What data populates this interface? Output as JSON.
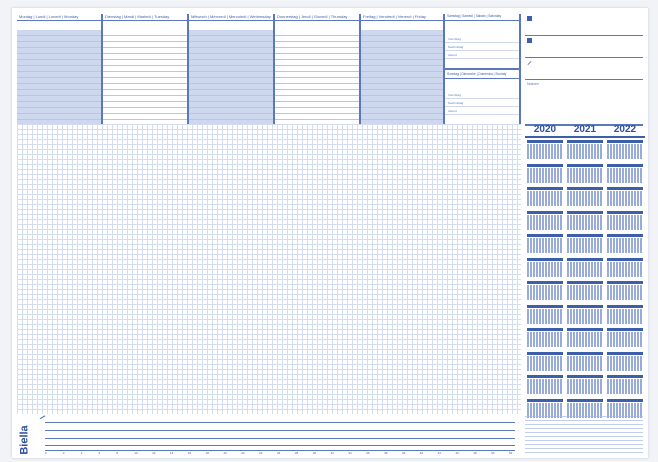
{
  "brand": {
    "name": "Biella"
  },
  "week": {
    "days": [
      {
        "title": "Montag | Lundi | Lunedì | Monday",
        "shaded": true
      },
      {
        "title": "Dienstag | Mardi | Martedì | Tuesday",
        "shaded": false
      },
      {
        "title": "Mittwoch | Mercredi | Mercoledì | Wednesday",
        "shaded": true
      },
      {
        "title": "Donnerstag | Jeudi | Giovedì | Thursday",
        "shaded": false
      },
      {
        "title": "Freitag | Vendredi | Venerdì | Friday",
        "shaded": true
      }
    ],
    "weekend": {
      "saturday_title": "Samstag | Samedi | Sabato | Saturday",
      "sunday_title": "Sonntag | Dimanche | Domenica | Sunday",
      "line_labels": [
        "Vormittag",
        "Nachmittag",
        "Abend"
      ]
    }
  },
  "notes": {
    "label": "Notizen"
  },
  "calendar": {
    "years": [
      "2020",
      "2021",
      "2022"
    ]
  },
  "ruler": {
    "numbers": [
      "0",
      "2",
      "4",
      "6",
      "8",
      "10",
      "12",
      "14",
      "16",
      "18",
      "20",
      "22",
      "24",
      "26",
      "28",
      "30",
      "32",
      "34",
      "36",
      "38",
      "40",
      "42",
      "44",
      "46",
      "48",
      "50",
      "52"
    ]
  }
}
